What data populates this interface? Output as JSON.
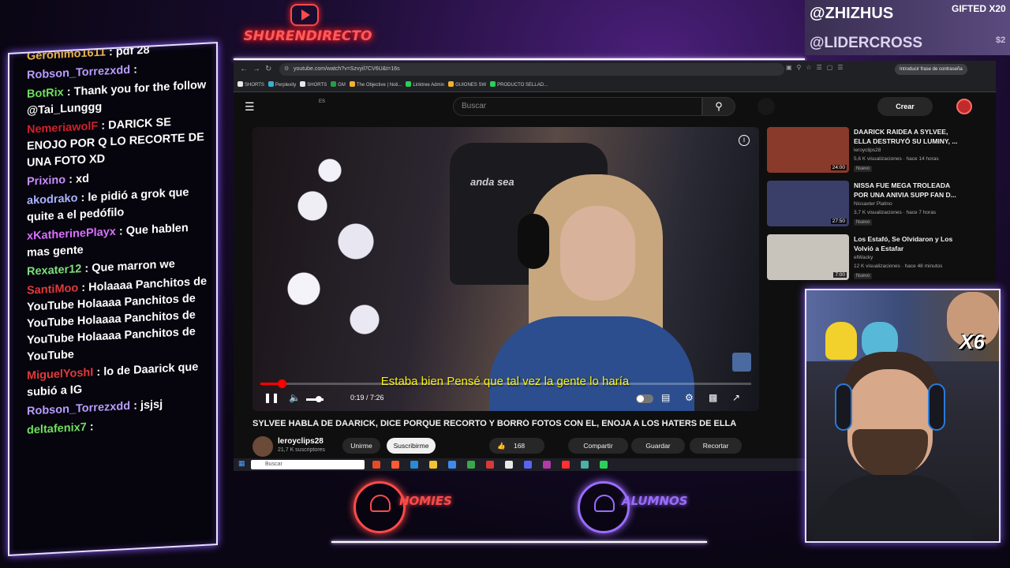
{
  "brand": {
    "name": "SHURENDIRECTO",
    "icon": "play-icon"
  },
  "gifts": {
    "user1": "@ZHIZHUS",
    "label": "GIFTED X20",
    "user2": "@LIDERCROSS",
    "amount": "$2"
  },
  "chat": {
    "messages": [
      {
        "user": "Geronimo1611",
        "user_color": "#e7b44a",
        "sep": " : ",
        "text": "pdf 28"
      },
      {
        "user": "Robson_Torrezxdd",
        "user_color": "#b89cff",
        "sep": " : ",
        "text": ""
      },
      {
        "user": "BotRix",
        "user_color": "#6ee05c",
        "sep": " : ",
        "text": "Thank you for the follow @Tai_Lunggg"
      },
      {
        "user": "NemeriawolF",
        "user_color": "#d0212a",
        "sep": " : ",
        "text": "DARICK SE ENOJO POR Q LO RECORTE DE UNA FOTO XD"
      },
      {
        "user": "Prixino",
        "user_color": "#c98cff",
        "sep": " : ",
        "text": "xd"
      },
      {
        "user": "akodrako",
        "user_color": "#a8b4ff",
        "sep": " : ",
        "text": "le pidió a grok que quite a el pedófilo"
      },
      {
        "user": "xKatherinePlayx",
        "user_color": "#d870ff",
        "sep": " : ",
        "text": "Que hablen mas gente"
      },
      {
        "user": "Rexater12",
        "user_color": "#7be07b",
        "sep": " : ",
        "text": "Que marron we"
      },
      {
        "user": "SantiMoo",
        "user_color": "#e03a3a",
        "sep": " : ",
        "text": "Holaaaa Panchitos de YouTube Holaaaa Panchitos de YouTube Holaaaa Panchitos de YouTube Holaaaa Panchitos de YouTube"
      },
      {
        "user": "MiguelYoshI",
        "user_color": "#e03a3a",
        "sep": " : ",
        "text": "lo de Daarick que subió a IG"
      },
      {
        "user": "Robson_Torrezxdd",
        "user_color": "#b89cff",
        "sep": " : ",
        "text": "jsjsj"
      },
      {
        "user": "deltafenix7",
        "user_color": "#6ee05c",
        "sep": " : ",
        "text": ""
      }
    ]
  },
  "browser": {
    "url": "youtube.com/watch?v=Szvyil7CV6U&t=16s",
    "password_pill": "Introducir frase de contraseña",
    "bookmarks": [
      "SHORTS",
      "Perplexity",
      "SHORTS",
      "GM",
      "The Objective | Noti...",
      "Linktree Admin",
      "GUIONES SW",
      "PRODUCTO SELLAD..."
    ]
  },
  "youtube": {
    "lang": "ES",
    "search_placeholder": "Buscar",
    "create_label": "Crear",
    "caption": "Estaba bien Pensé que tal vez la gente lo haría",
    "timecode": "0:19 / 7:26",
    "progress": 0.043,
    "chair_brand": "anda sea",
    "title": "SYLVEE HABLA DE DAARICK, DICE PORQUE RECORTO Y BORRÓ FOTOS CON EL, ENOJA A LOS HATERS DE ELLA",
    "channel": "leroyclips28",
    "subscribers": "21,7 K suscriptores",
    "join_label": "Unirme",
    "subscribe_label": "Suscribirme",
    "likes": "168",
    "share_label": "Compartir",
    "save_label": "Guardar",
    "clip_label": "Recortar",
    "taskbar_search": "Buscar"
  },
  "recommendations": [
    {
      "title": "DAARICK RAIDEA A SYLVEE, ELLA DESTRUYÓ SU LUMINY, ...",
      "channel": "leroyclips28",
      "stats": "5,6 K visualizaciones · hace 14 horas",
      "badge": "Nuevo",
      "duration": "24:00",
      "thumb_color": "#8a3a2a"
    },
    {
      "title": "NISSA FUE MEGA TROLEADA POR UNA ANIVIA SUPP FAN D...",
      "channel": "Nissaxter Platino",
      "stats": "3,7 K visualizaciones · hace 7 horas",
      "badge": "Nuevo",
      "duration": "27:50",
      "thumb_color": "#3a3f6a"
    },
    {
      "title": "Los Estafó, Se Olvidaron y Los Volvió a Estafar",
      "channel": "elWacky",
      "stats": "12 K visualizaciones · hace 48 minutos",
      "badge": "Nuevo",
      "duration": "7:00",
      "thumb_color": "#c8c4bc"
    }
  ],
  "webcam": {
    "multiplier": "X6"
  },
  "bottom_logos": [
    {
      "label": "HOMIES",
      "color": "#ff4a4a"
    },
    {
      "label": "ALUMNOS",
      "color": "#9b6cff"
    }
  ],
  "colors": {
    "accent_neon": "#8a5cff",
    "youtube_red": "#ff0000",
    "caption_yellow": "#f6f000"
  }
}
